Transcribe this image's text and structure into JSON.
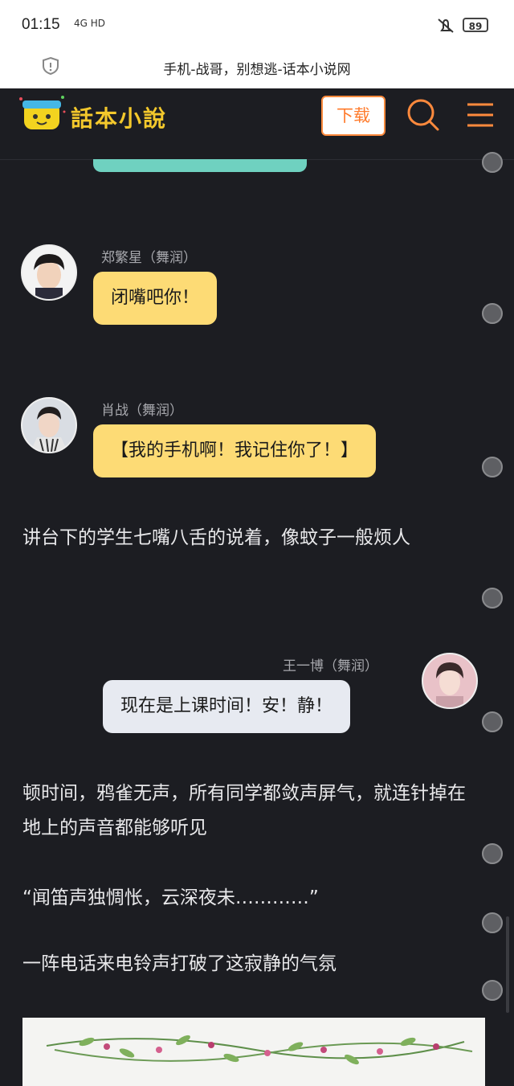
{
  "status": {
    "time": "01:15",
    "network": "4G HD",
    "battery": "89"
  },
  "browser": {
    "page_title": "手机-战哥，别想逃-话本小说网"
  },
  "header": {
    "logo_text": "話本小說",
    "download_label": "下载"
  },
  "chat": [
    {
      "speaker": "郑繁星（舞润）",
      "text": "闭嘴吧你！",
      "side": "left",
      "bubble_color": "#fddb75"
    },
    {
      "speaker": "肖战（舞润）",
      "text": "【我的手机啊！我记住你了！】",
      "side": "left",
      "bubble_color": "#fddb75"
    },
    {
      "speaker": "王一博（舞润）",
      "text": "现在是上课时间！安！静！",
      "side": "right",
      "bubble_color": "#e7eaf1"
    }
  ],
  "narration": [
    "讲台下的学生七嘴八舌的说着，像蚊子一般烦人",
    "顿时间，鸦雀无声，所有同学都敛声屏气，就连针掉在地上的声音都能够听见",
    "“闻笛声独惆怅，云深夜未…………”",
    "一阵电话来电铃声打破了这寂静的气氛"
  ],
  "colors": {
    "background": "#1c1d22",
    "accent_orange": "#ff7a2a",
    "logo_yellow": "#f3c82c",
    "teal": "#6fd1c0"
  }
}
